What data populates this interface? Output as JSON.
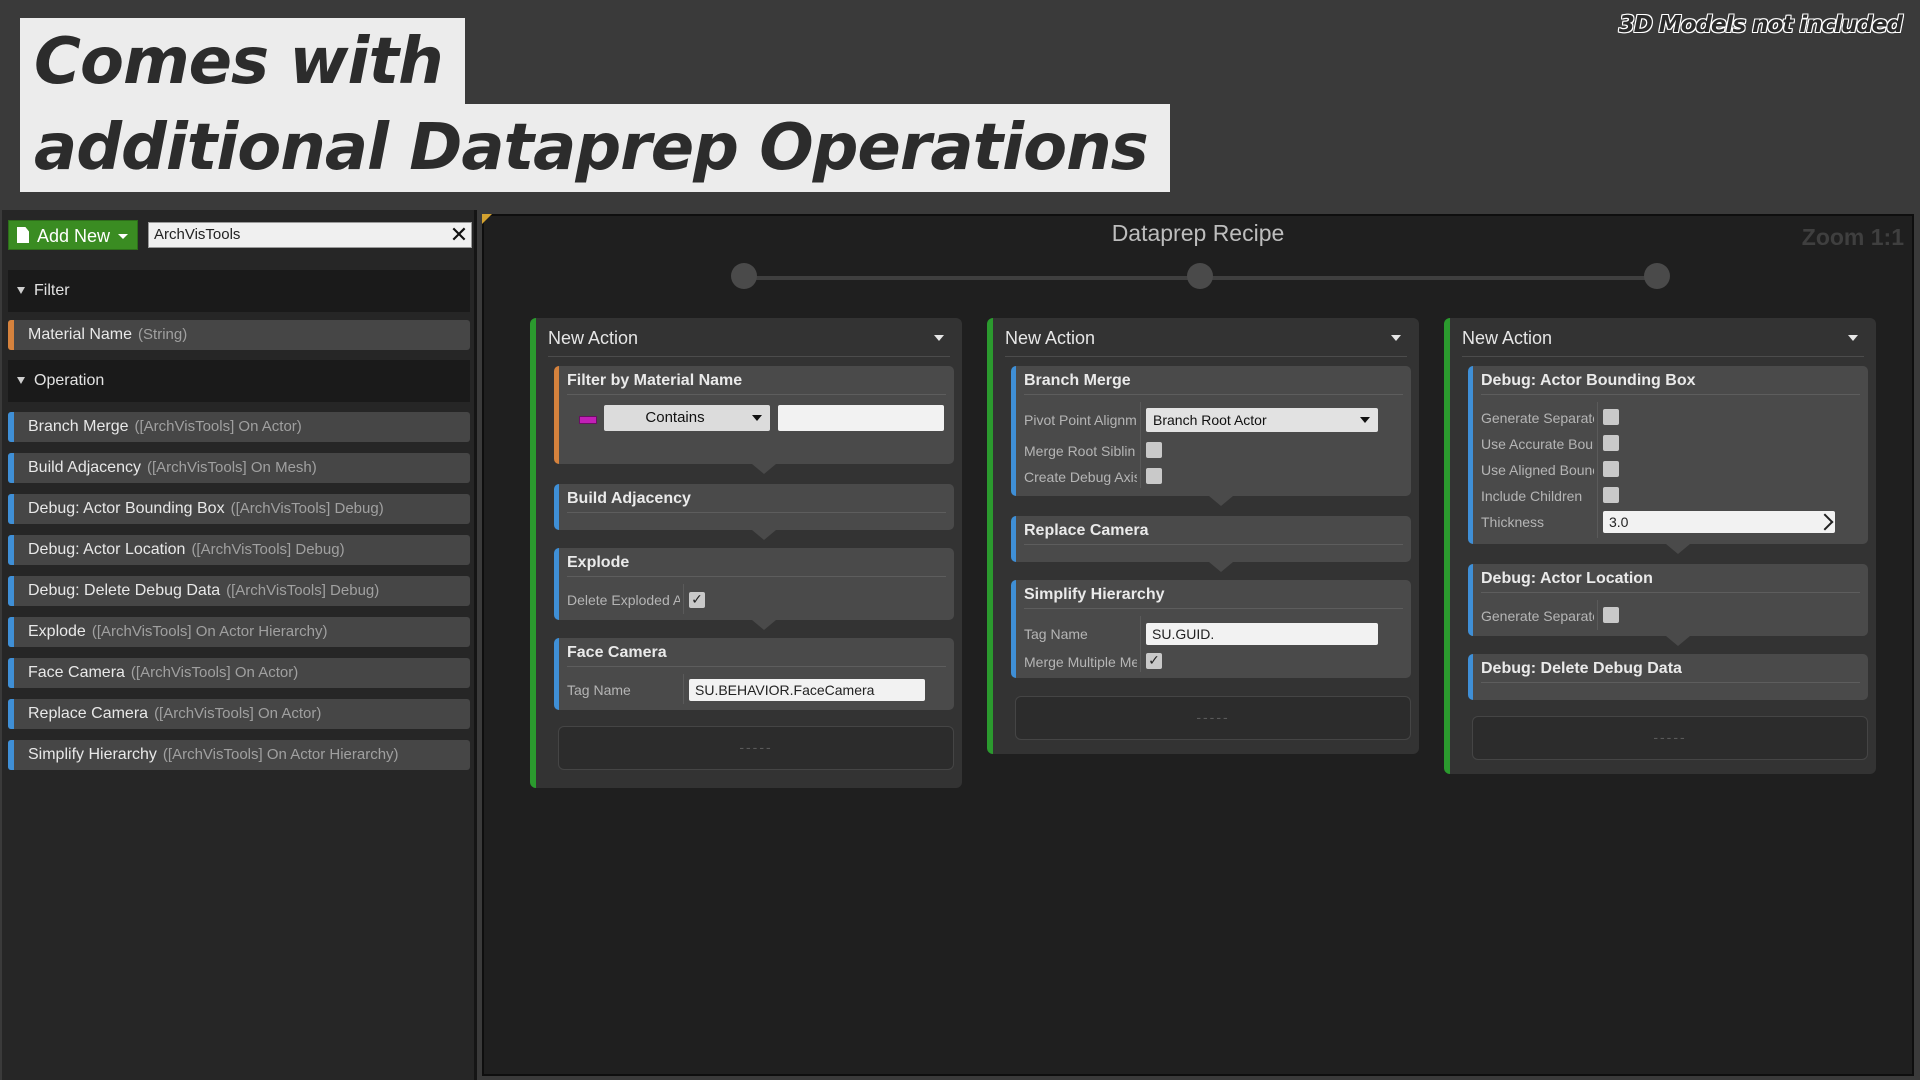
{
  "banner": {
    "line1": "Comes with",
    "line2": "additional Dataprep Operations",
    "disclaimer": "3D Models not included"
  },
  "palette": {
    "add_new_label": "Add New",
    "search_value": "ArchVisTools",
    "clear_glyph": "✕",
    "filter_category": "Filter",
    "operation_category": "Operation",
    "filters": [
      {
        "name": "Material Name",
        "meta": "(String)",
        "color": "#d5823d"
      }
    ],
    "operations": [
      {
        "name": "Branch Merge",
        "meta": "([ArchVisTools] On Actor)"
      },
      {
        "name": "Build Adjacency",
        "meta": "([ArchVisTools] On Mesh)"
      },
      {
        "name": "Debug: Actor Bounding Box",
        "meta": "([ArchVisTools] Debug)"
      },
      {
        "name": "Debug: Actor Location",
        "meta": "([ArchVisTools] Debug)"
      },
      {
        "name": "Debug: Delete Debug Data",
        "meta": "([ArchVisTools] Debug)"
      },
      {
        "name": "Explode",
        "meta": "([ArchVisTools] On Actor Hierarchy)"
      },
      {
        "name": "Face Camera",
        "meta": "([ArchVisTools] On Actor)"
      },
      {
        "name": "Replace Camera",
        "meta": "([ArchVisTools] On Actor)"
      },
      {
        "name": "Simplify Hierarchy",
        "meta": "([ArchVisTools] On Actor Hierarchy)"
      }
    ],
    "operation_color": "#3f8fd6"
  },
  "graph": {
    "title": "Dataprep Recipe",
    "zoom": "Zoom 1:1",
    "action_color": "#2b9a2e"
  },
  "actions": [
    {
      "header": "New Action",
      "steps": {
        "filter_material": {
          "title": "Filter by Material Name",
          "match_option": "Contains",
          "match_value": ""
        },
        "build_adjacency": {
          "title": "Build Adjacency"
        },
        "explode": {
          "title": "Explode",
          "prop_label": "Delete Exploded A",
          "checked": true
        },
        "face_camera": {
          "title": "Face Camera",
          "prop_label": "Tag Name",
          "tag_value": "SU.BEHAVIOR.FaceCamera"
        }
      },
      "drop_zone": "-----"
    },
    {
      "header": "New Action",
      "steps": {
        "branch_merge": {
          "title": "Branch Merge",
          "pivot_label": "Pivot Point Alignm",
          "pivot_value": "Branch Root Actor",
          "merge_root_label": "Merge Root Siblin",
          "merge_root_checked": false,
          "debug_axis_label": "Create Debug Axis",
          "debug_axis_checked": false
        },
        "replace_camera": {
          "title": "Replace Camera"
        },
        "simplify_hierarchy": {
          "title": "Simplify Hierarchy",
          "tag_label": "Tag Name",
          "tag_value": "SU.GUID.",
          "merge_multiple_label": "Merge Multiple Me",
          "merge_multiple_checked": true
        }
      },
      "drop_zone": "-----"
    },
    {
      "header": "New Action",
      "steps": {
        "bounding_box": {
          "title": "Debug: Actor Bounding Box",
          "props": [
            {
              "label": "Generate Separate",
              "checked": false
            },
            {
              "label": "Use Accurate Bour",
              "checked": false
            },
            {
              "label": "Use Aligned Bounc",
              "checked": false
            },
            {
              "label": "Include Children",
              "checked": false
            }
          ],
          "thickness_label": "Thickness",
          "thickness_value": "3.0"
        },
        "actor_location": {
          "title": "Debug: Actor Location",
          "prop_label": "Generate Separate",
          "checked": false
        },
        "delete_debug": {
          "title": "Debug: Delete Debug Data"
        }
      },
      "drop_zone": "-----"
    }
  ]
}
